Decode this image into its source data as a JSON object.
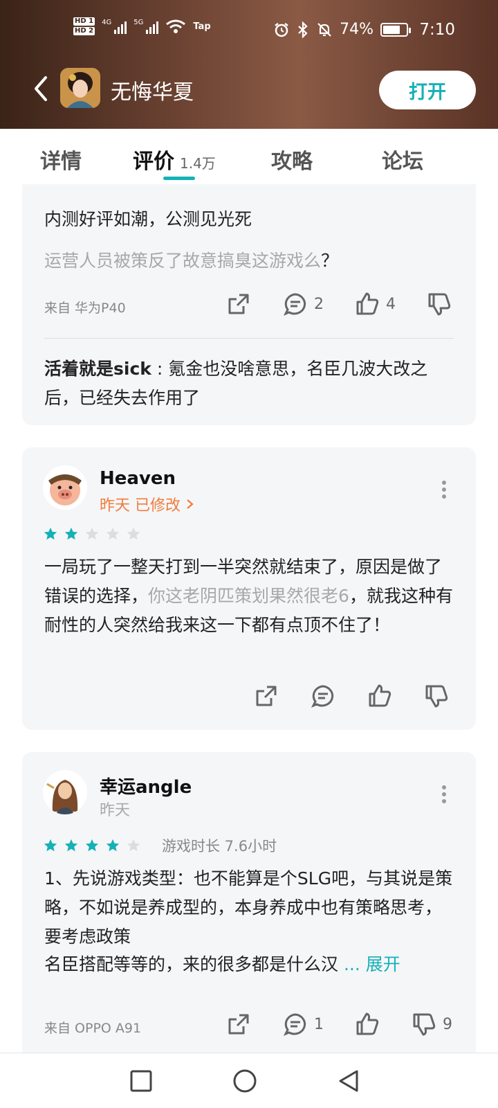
{
  "status_bar": {
    "hd1": "HD 1",
    "hd2": "HD 2",
    "net1": "4G",
    "net2": "5G",
    "wifi_tag": "Tap",
    "battery": "74%",
    "battery_level": 0.74,
    "time": "7:10"
  },
  "header": {
    "app_title": "无悔华夏",
    "open_button": "打开"
  },
  "tabs": [
    {
      "label": "详情"
    },
    {
      "label": "评价",
      "count": "1.4万",
      "active": true
    },
    {
      "label": "攻略"
    },
    {
      "label": "论坛"
    }
  ],
  "review1": {
    "line1": "内测好评如潮，公测见光死",
    "line2": "运营人员被策反了故意搞臭这游戏么",
    "line2_end": "？",
    "device": "来自 华为P40",
    "comments": "2",
    "likes": "4",
    "reply_user": "活着就是sick",
    "reply_sep": " : ",
    "reply_text": "氪金也没啥意思，名臣几波大改之后，已经失去作用了"
  },
  "review2": {
    "username": "Heaven",
    "date": "昨天 已修改",
    "rating": 2,
    "text_a": "一局玩了一整天打到一半突然就结束了，原因是做了错误的选择，",
    "text_b": "你这老阴匹策划果然很老6",
    "text_c": "，就我这种有耐性的人突然给我来这一下都有点顶不住了！"
  },
  "review3": {
    "username": "幸运angle",
    "date": "昨天",
    "rating": 4,
    "playtime": "游戏时长 7.6小时",
    "para1": "1、先说游戏类型：也不能算是个SLG吧，与其说是策略，不如说是养成型的，本身养成中也有策略思考，要考虑政策",
    "para2": "名臣搭配等等的，来的很多都是什么汉",
    "expand": "... 展开",
    "device": "来自 OPPO A91",
    "comments": "1",
    "dislikes": "9"
  },
  "colors": {
    "accent": "#15b1b7",
    "orange": "#f07c3a",
    "card_bg": "#f5f6f8"
  }
}
